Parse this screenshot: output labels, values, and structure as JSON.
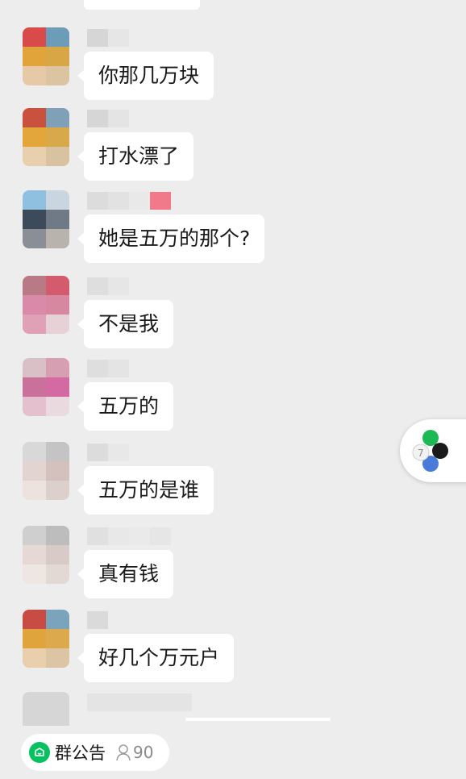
{
  "chat": {
    "messages": [
      {
        "text": "你那几万块"
      },
      {
        "text": "打水漂了"
      },
      {
        "text": "她是五万的那个?"
      },
      {
        "text": "不是我"
      },
      {
        "text": "五万的"
      },
      {
        "text": "五万的是谁"
      },
      {
        "text": "真有钱"
      },
      {
        "text": "好几个万元户"
      }
    ]
  },
  "footer": {
    "notice_label": "群公告",
    "member_count": "90",
    "notice_icon": "announcement-icon",
    "member_icon": "person-icon"
  },
  "floating_button": {
    "icon": "color-dots-icon",
    "colors": [
      "#1db954",
      "#1a1a1a",
      "#4a7bd8",
      "#f2f2f2"
    ]
  },
  "colors": {
    "background": "#ededed",
    "bubble": "#ffffff",
    "accent_green": "#07c160"
  }
}
